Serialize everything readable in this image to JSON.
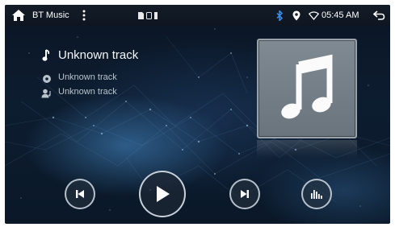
{
  "status_bar": {
    "app_title": "BT Music",
    "time": "05:45 AM",
    "icons": [
      "home-icon",
      "menu-dots-icon",
      "sd-card-icon",
      "usb-icon",
      "bluetooth-icon",
      "location-icon",
      "wifi-icon",
      "back-icon"
    ]
  },
  "track": {
    "title": "Unknown track",
    "album": "Unknown track",
    "artist": "Unknown track"
  },
  "controls": {
    "previous": "skip-previous-icon",
    "play": "play-icon",
    "next": "skip-next-icon",
    "equalizer": "equalizer-icon"
  },
  "colors": {
    "accent_bluetooth": "#3a8df0",
    "background": "#0c1a2b"
  }
}
